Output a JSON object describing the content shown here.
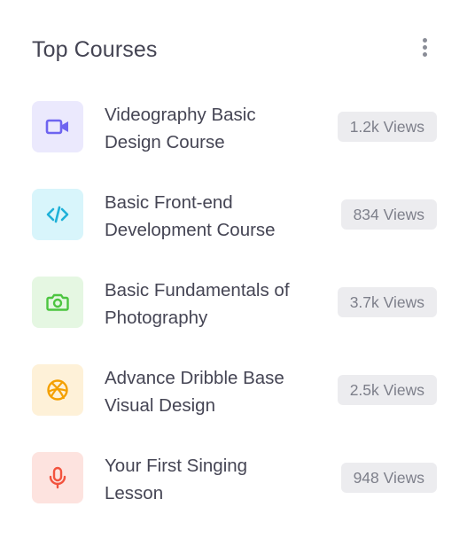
{
  "card": {
    "title": "Top Courses",
    "menu_icon": "more-vertical-icon"
  },
  "courses": [
    {
      "name": "Videography Basic Design Course",
      "views": "1.2k Views",
      "icon": "video-camera-icon",
      "icon_color": "#6e64f0",
      "icon_bg": "#ebe9fd"
    },
    {
      "name": "Basic Front-end Development Course",
      "views": "834 Views",
      "icon": "code-icon",
      "icon_color": "#1fb1d8",
      "icon_bg": "#d8f5fb"
    },
    {
      "name": "Basic Fundamentals of Photography",
      "views": "3.7k Views",
      "icon": "camera-icon",
      "icon_color": "#4cc540",
      "icon_bg": "#e5f7e2"
    },
    {
      "name": "Advance Dribble Base Visual Design",
      "views": "2.5k Views",
      "icon": "dribbble-icon",
      "icon_color": "#f4a000",
      "icon_bg": "#fef1d8"
    },
    {
      "name": "Your First Singing Lesson",
      "views": "948 Views",
      "icon": "microphone-icon",
      "icon_color": "#f2533e",
      "icon_bg": "#fde3df"
    }
  ]
}
